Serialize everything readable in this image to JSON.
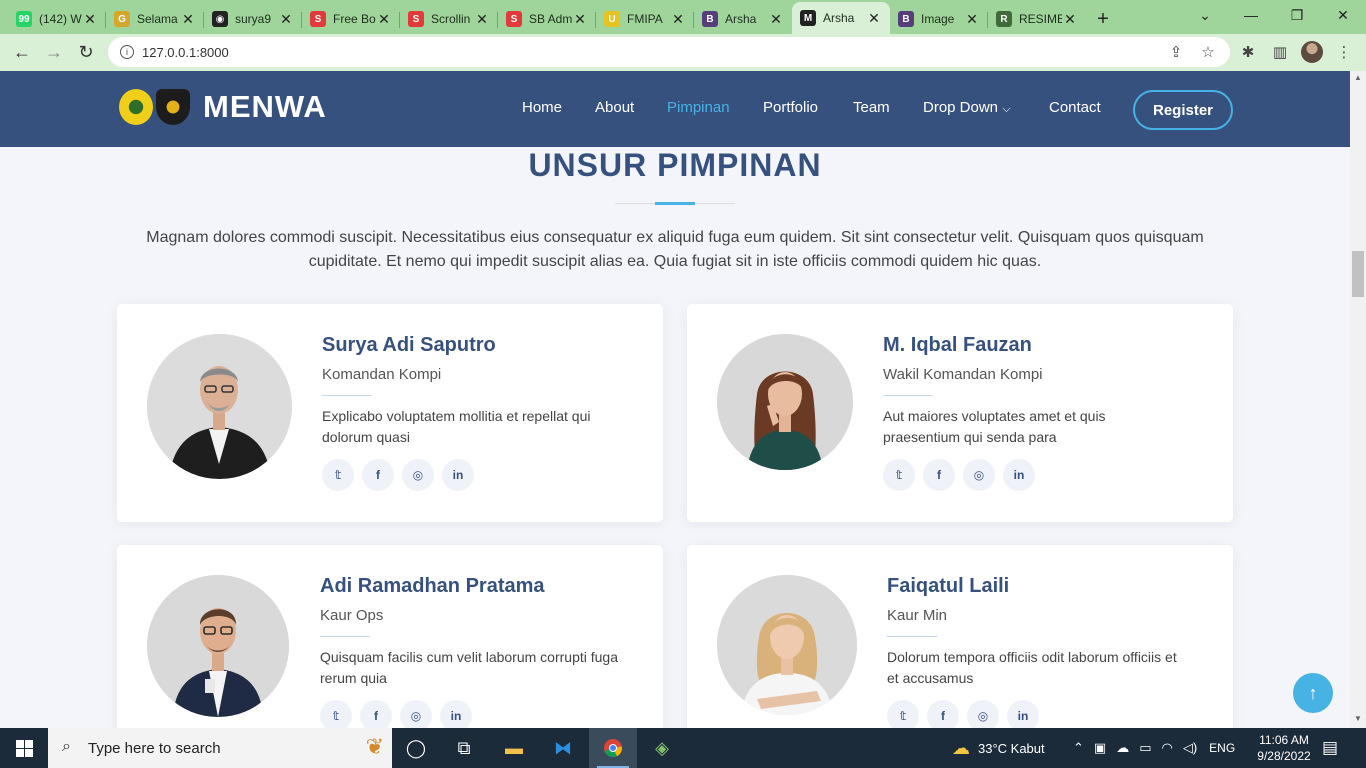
{
  "browser": {
    "tabs": [
      {
        "title": "(142) W",
        "favicon": "whatsapp-icon",
        "color": "#25d366",
        "glyph": "99"
      },
      {
        "title": "Selama",
        "favicon": "garuda-icon",
        "color": "#d4a72c",
        "glyph": "G"
      },
      {
        "title": "surya9",
        "favicon": "github-icon",
        "color": "#222222",
        "glyph": "◉"
      },
      {
        "title": "Free Bo",
        "favicon": "s-icon",
        "color": "#e23a3a",
        "glyph": "S"
      },
      {
        "title": "Scrollin",
        "favicon": "s-icon",
        "color": "#e23a3a",
        "glyph": "S"
      },
      {
        "title": "SB Adm",
        "favicon": "s-icon",
        "color": "#e23a3a",
        "glyph": "S"
      },
      {
        "title": "FMIPA",
        "favicon": "university-icon",
        "color": "#e6c323",
        "glyph": "U"
      },
      {
        "title": "Arsha",
        "favicon": "bootstrap-icon",
        "color": "#563d7c",
        "glyph": "B"
      },
      {
        "title": "Arsha",
        "favicon": "menwa-icon",
        "color": "#222222",
        "glyph": "M",
        "active": true
      },
      {
        "title": "Image",
        "favicon": "bootstrap-icon",
        "color": "#563d7c",
        "glyph": "B"
      },
      {
        "title": "RESIME",
        "favicon": "resimen-icon",
        "color": "#3f6b3a",
        "glyph": "R"
      }
    ],
    "url": "127.0.0.1:8000"
  },
  "site": {
    "brand": "MENWA",
    "nav": [
      {
        "label": "Home"
      },
      {
        "label": "About"
      },
      {
        "label": "Pimpinan",
        "active": true
      },
      {
        "label": "Portfolio"
      },
      {
        "label": "Team"
      },
      {
        "label": "Drop Down"
      },
      {
        "label": "Contact"
      }
    ],
    "register": "Register",
    "accent": "#47b2e4",
    "primary": "#37517e"
  },
  "section": {
    "title": "UNSUR PIMPINAN",
    "intro": "Magnam dolores commodi suscipit. Necessitatibus eius consequatur ex aliquid fuga eum quidem. Sit sint consectetur velit. Quisquam quos quisquam cupiditate. Et nemo qui impedit suscipit alias ea. Quia fugiat sit in iste officiis commodi quidem hic quas."
  },
  "members": [
    {
      "name": "Surya Adi Saputro",
      "role": "Komandan Kompi",
      "desc": "Explicabo voluptatem mollitia et repellat qui dolorum quasi"
    },
    {
      "name": "M. Iqbal Fauzan",
      "role": "Wakil Komandan Kompi",
      "desc": "Aut maiores voluptates amet et quis praesentium qui senda para"
    },
    {
      "name": "Adi Ramadhan Pratama",
      "role": "Kaur Ops",
      "desc": "Quisquam facilis cum velit laborum corrupti fuga rerum quia"
    },
    {
      "name": "Faiqatul Laili",
      "role": "Kaur Min",
      "desc": "Dolorum tempora officiis odit laborum officiis et et accusamus"
    }
  ],
  "social_icons": [
    "twitter-icon",
    "facebook-icon",
    "instagram-icon",
    "linkedin-icon"
  ],
  "taskbar": {
    "search_placeholder": "Type here to search",
    "weather": "33°C  Kabut",
    "lang": "ENG",
    "time": "11:06 AM",
    "date": "9/28/2022"
  }
}
